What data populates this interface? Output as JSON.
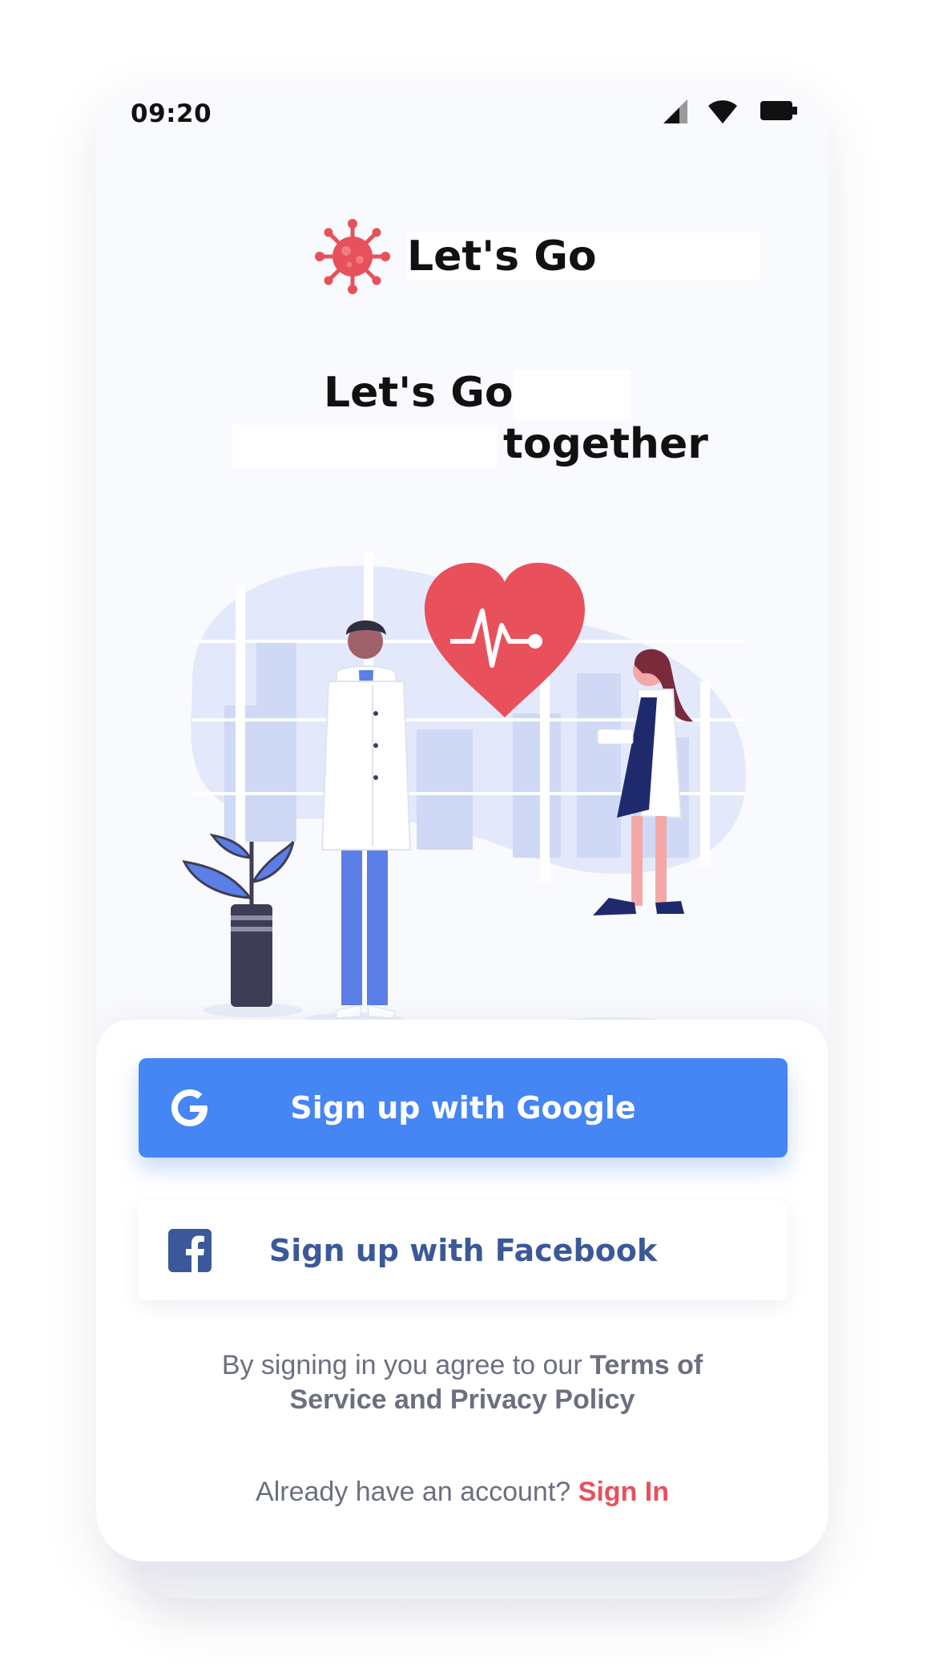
{
  "status_bar": {
    "time": "09:20"
  },
  "header": {
    "brand": "Let's Go"
  },
  "headline": {
    "line1": "Let's Go",
    "line2": "together"
  },
  "actions": {
    "google_label": "Sign up with Google",
    "facebook_label": "Sign up with Facebook"
  },
  "terms": {
    "prefix": "By signing in you agree to our ",
    "link_line1": "Terms of",
    "link_line2": "Service and Privacy Policy"
  },
  "signin": {
    "prompt": "Already have an account? ",
    "link": "Sign In"
  },
  "colors": {
    "accent": "#e8505b",
    "google": "#4585f4",
    "facebook": "#3b5998",
    "illustration_blue": "#5b7fe6"
  }
}
